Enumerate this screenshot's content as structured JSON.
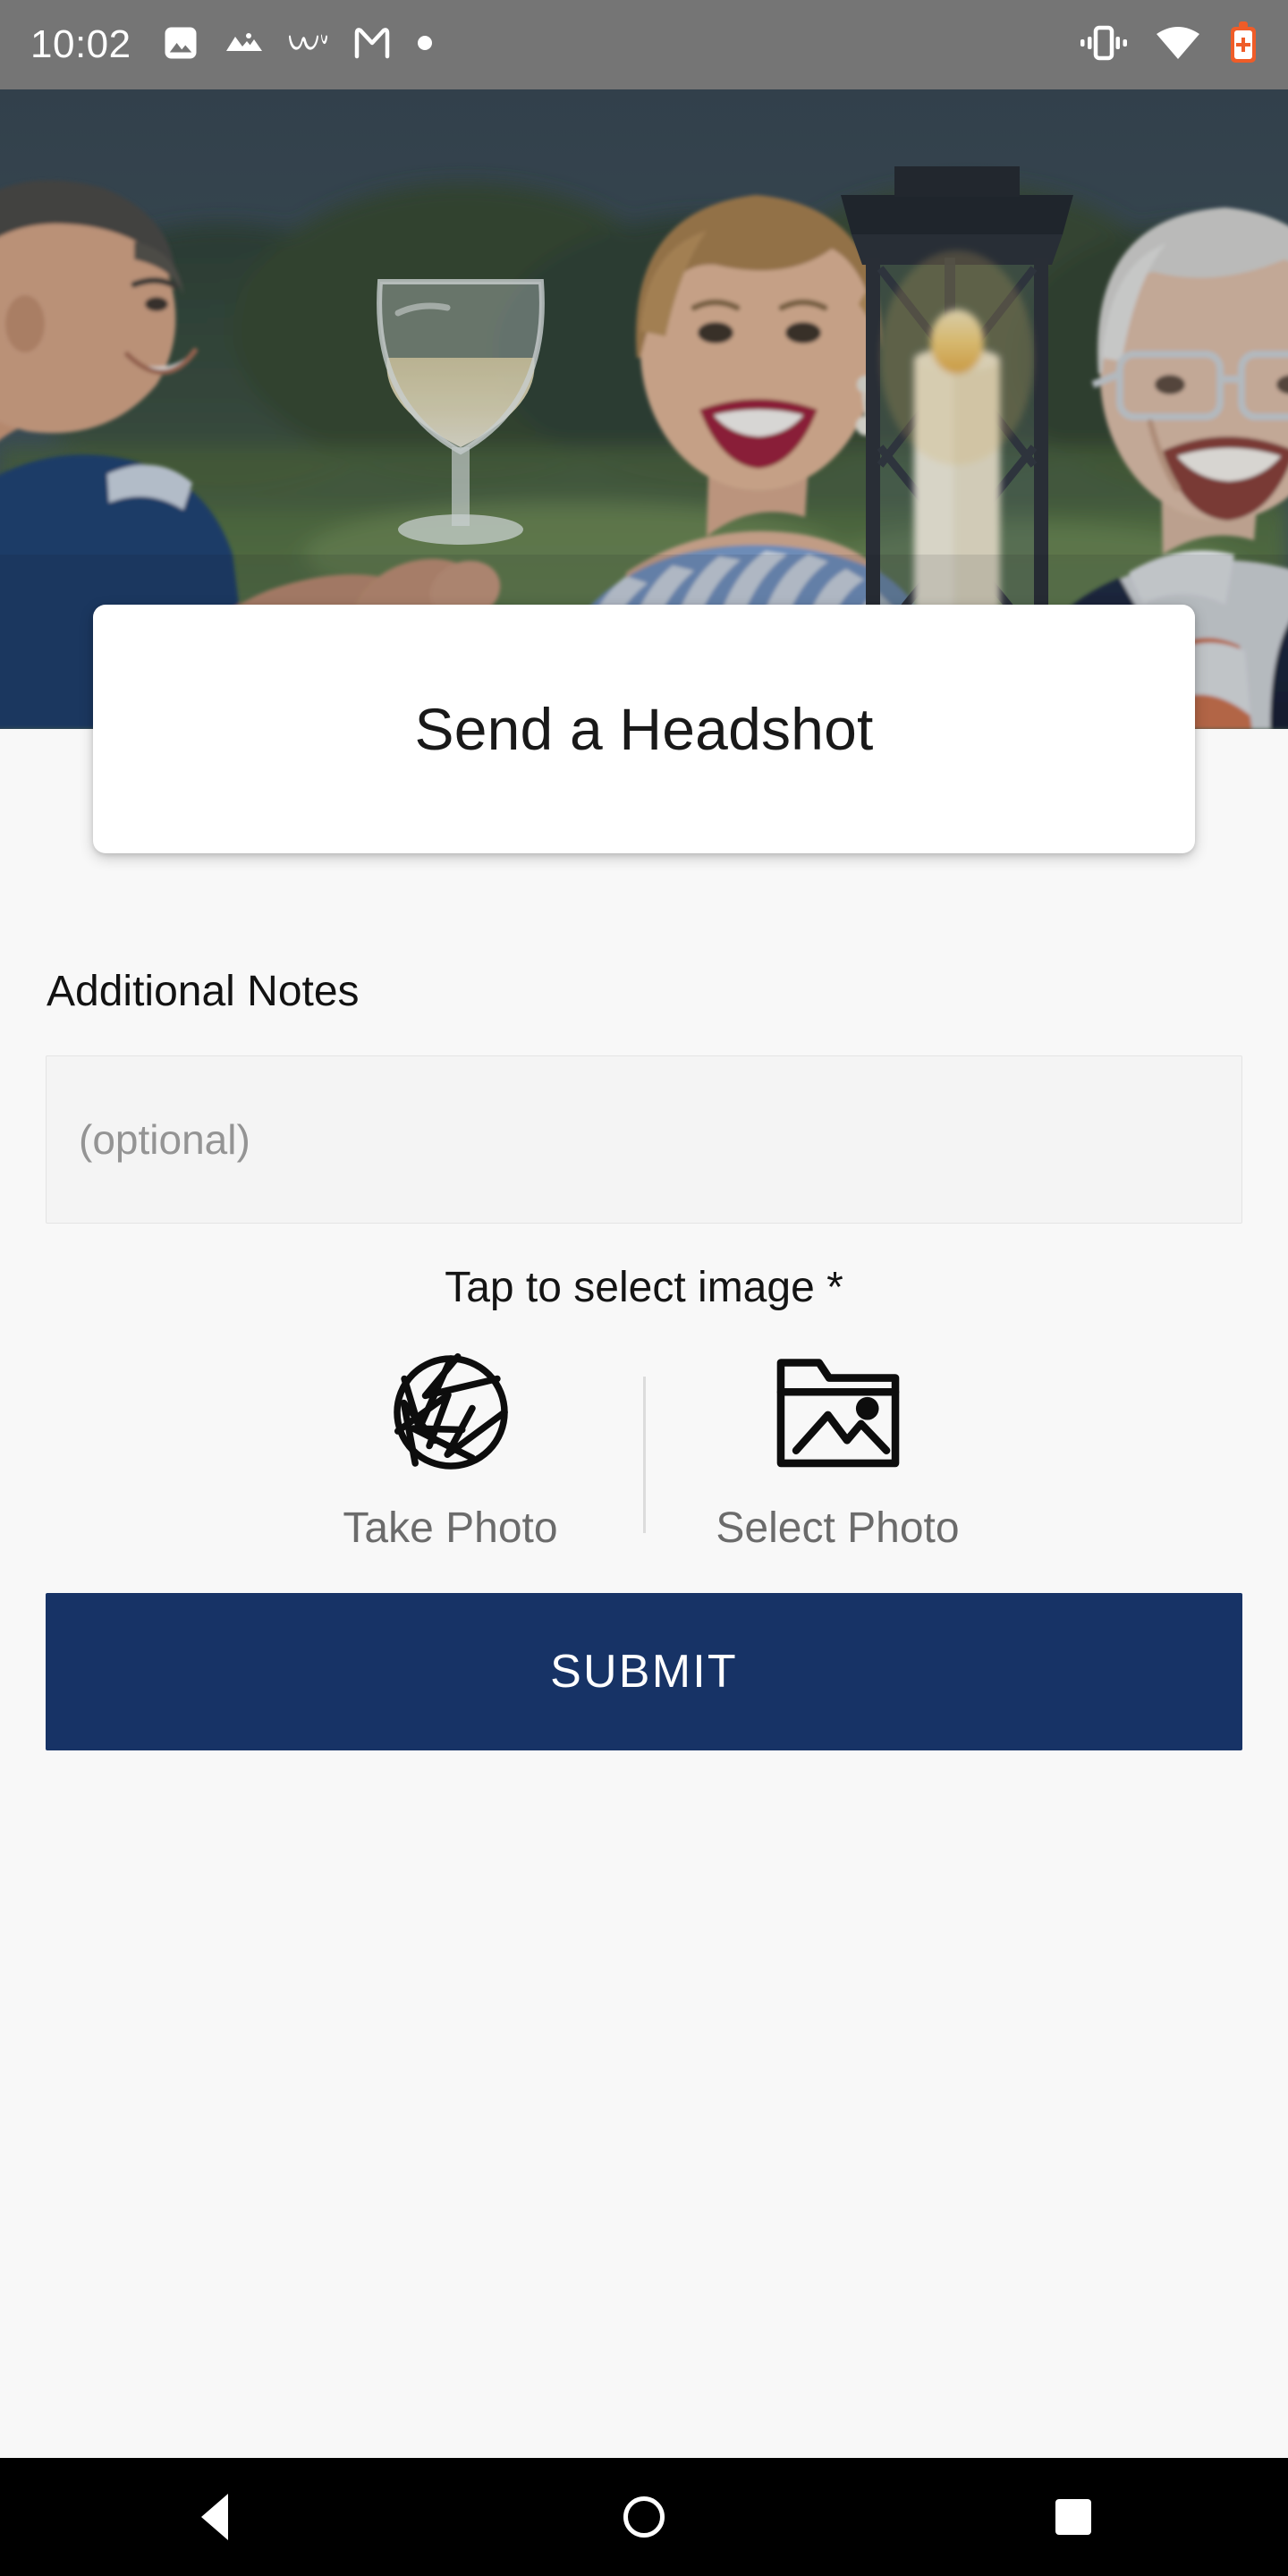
{
  "status_bar": {
    "clock": "10:02",
    "background_color": "#757575",
    "left_icons": [
      {
        "name": "image-notification-icon",
        "glyph": "photo"
      },
      {
        "name": "mountains-notification-icon",
        "glyph": "mountains"
      },
      {
        "name": "wave-notification-icon",
        "glyph": "wave"
      },
      {
        "name": "gmail-notification-icon",
        "glyph": "M"
      },
      {
        "name": "more-notifications-dot-icon",
        "glyph": "dot"
      }
    ],
    "right_icons": [
      {
        "name": "vibrate-icon",
        "glyph": "vibrate"
      },
      {
        "name": "wifi-icon",
        "glyph": "wifi"
      },
      {
        "name": "battery-saver-icon",
        "glyph": "battery-plus",
        "color": "#ef5c28"
      }
    ]
  },
  "hero": {
    "alt": "Three smiling seniors socializing outdoors at dusk with a glass of white wine and a lantern with a lit candle",
    "name": "hero-banner-image"
  },
  "title_card": {
    "title": "Send a Headshot"
  },
  "form": {
    "notes_label": "Additional Notes",
    "notes_value": "",
    "notes_placeholder": "(optional)",
    "tap_hint": "Tap to select image *",
    "options": [
      {
        "label": "Take Photo",
        "icon": "camera-aperture-icon"
      },
      {
        "label": "Select Photo",
        "icon": "photo-folder-icon"
      }
    ],
    "submit_label": "SUBMIT",
    "submit_color": "#173366"
  },
  "nav_bar": {
    "back_label": "Back",
    "home_label": "Home",
    "recents_label": "Recents"
  }
}
